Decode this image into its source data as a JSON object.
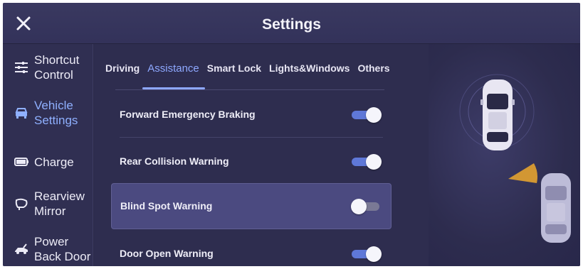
{
  "header": {
    "title": "Settings",
    "close_icon": "close-icon"
  },
  "sidebar": {
    "items": [
      {
        "label": "Shortcut\nControl",
        "icon": "sliders-icon",
        "active": false
      },
      {
        "label": "Vehicle\nSettings",
        "icon": "car-icon",
        "active": true
      },
      {
        "label": "Charge",
        "icon": "battery-icon",
        "active": false
      },
      {
        "label": "Rearview\nMirror",
        "icon": "mirror-icon",
        "active": false
      },
      {
        "label": "Power\nBack Door",
        "icon": "back-door-icon",
        "active": false
      }
    ]
  },
  "tabs": [
    {
      "label": "Driving",
      "active": false
    },
    {
      "label": "Assistance",
      "active": true
    },
    {
      "label": "Smart Lock",
      "active": false
    },
    {
      "label": "Lights&Windows",
      "active": false
    },
    {
      "label": "Others",
      "active": false
    }
  ],
  "settings": [
    {
      "label": "Forward Emergency Braking",
      "on": true,
      "highlighted": false
    },
    {
      "label": "Rear Collision Warning",
      "on": true,
      "highlighted": false
    },
    {
      "label": "Blind Spot Warning",
      "on": false,
      "highlighted": true
    },
    {
      "label": "Door Open Warning",
      "on": true,
      "highlighted": false
    }
  ],
  "colors": {
    "accent": "#8ea8ff",
    "toggle_on": "#5f78d8",
    "blind_spot_zone": "#e0a030"
  }
}
